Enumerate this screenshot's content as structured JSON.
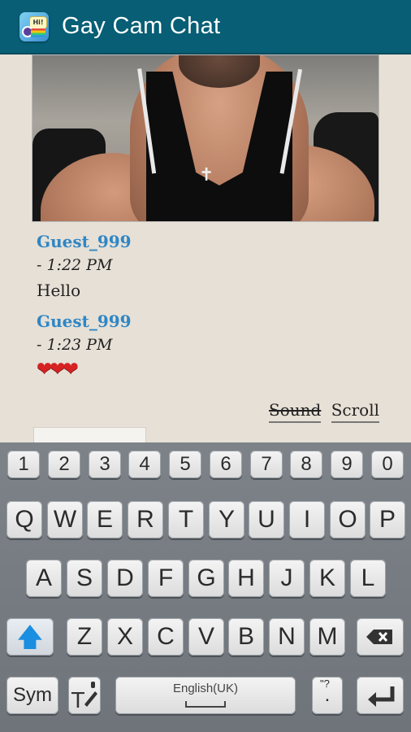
{
  "app": {
    "title": "Gay Cam Chat",
    "icon": "chat-app-icon",
    "icon_text": "Hi!",
    "bar_color": "#075e75"
  },
  "video": {
    "description_icon": "webcam-video-feed"
  },
  "messages": [
    {
      "user": "Guest_999",
      "time": "- 1:22 PM",
      "text": "Hello"
    },
    {
      "user": "Guest_999",
      "time": "- 1:23 PM",
      "text": "❤❤❤"
    }
  ],
  "controls": {
    "sound_label": "Sound",
    "scroll_label": "Scroll"
  },
  "keyboard": {
    "numbers": [
      "1",
      "2",
      "3",
      "4",
      "5",
      "6",
      "7",
      "8",
      "9",
      "0"
    ],
    "row1": [
      "Q",
      "W",
      "E",
      "R",
      "T",
      "Y",
      "U",
      "I",
      "O",
      "P"
    ],
    "row2": [
      "A",
      "S",
      "D",
      "F",
      "G",
      "H",
      "J",
      "K",
      "L"
    ],
    "row3": [
      "Z",
      "X",
      "C",
      "V",
      "B",
      "N",
      "M"
    ],
    "sym_label": "Sym",
    "space_label": "English(UK)",
    "punct_label": ".",
    "punct_top": "\"?"
  }
}
